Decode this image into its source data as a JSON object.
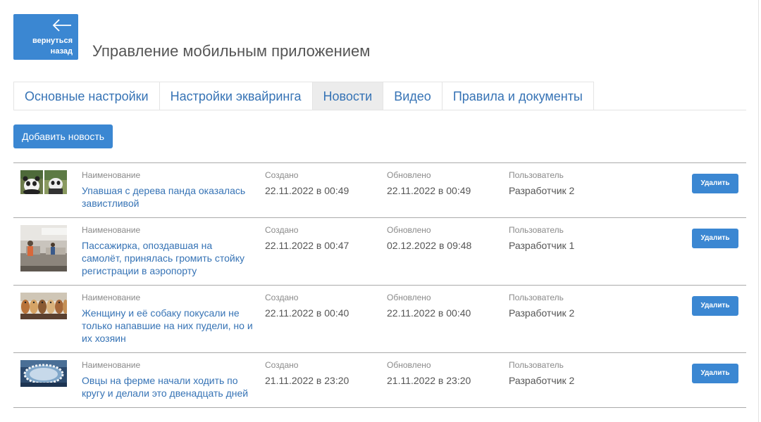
{
  "back_button": {
    "label": "вернуться\nназад",
    "icon": "arrow-left-icon"
  },
  "page_title": "Управление мобильным приложением",
  "tabs": [
    {
      "label": "Основные настройки",
      "active": false
    },
    {
      "label": "Настройки эквайринга",
      "active": false
    },
    {
      "label": "Новости",
      "active": true
    },
    {
      "label": "Видео",
      "active": false
    },
    {
      "label": "Правила и документы",
      "active": false
    }
  ],
  "add_news_button": "Добавить новость",
  "columns": {
    "name": "Наименование",
    "created": "Создано",
    "updated": "Обновлено",
    "user": "Пользователь"
  },
  "delete_label": "Удалить",
  "news": [
    {
      "title": "Упавшая с дерева панда оказалась завистливой",
      "created": "22.11.2022 в 00:49",
      "updated": "22.11.2022 в 00:49",
      "user": "Разработчик 2",
      "thumbnail": "panda-photo"
    },
    {
      "title": "Пассажирка, опоздавшая на самолёт, принялась громить стойку регистрации в аэропорту",
      "created": "22.11.2022 в 00:47",
      "updated": "02.12.2022 в 09:48",
      "user": "Разработчик 1",
      "thumbnail": "airport-photo"
    },
    {
      "title": "Женщину и её собаку покусали не только напавшие на них пудели, но и их хозяин",
      "created": "22.11.2022 в 00:40",
      "updated": "22.11.2022 в 00:40",
      "user": "Разработчик 2",
      "thumbnail": "poodles-photo"
    },
    {
      "title": "Овцы на ферме начали ходить по кругу и делали это двенадцать дней",
      "created": "21.11.2022 в 23:20",
      "updated": "21.11.2022 в 23:20",
      "user": "Разработчик 2",
      "thumbnail": "sheep-circle-photo"
    }
  ],
  "colors": {
    "primary": "#3b87d2",
    "link": "#3673b5",
    "active_tab_bg": "#ececec"
  }
}
